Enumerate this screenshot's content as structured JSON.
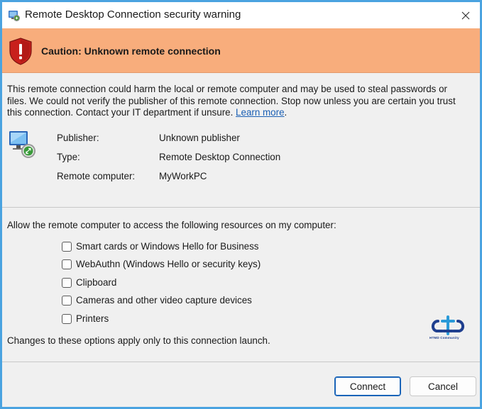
{
  "window": {
    "title": "Remote Desktop Connection security warning",
    "close_glyph": "✕"
  },
  "banner": {
    "text": "Caution: Unknown remote connection",
    "color": "#f8ad7c"
  },
  "warning": {
    "text": "This remote connection could harm the local or remote computer and may be used to steal passwords or files. We could not verify the publisher of this remote connection. Stop now unless you are certain you trust this connection. Contact your IT department if unsure. ",
    "link": "Learn more",
    "trailing": "."
  },
  "info": {
    "publisher_label": "Publisher:",
    "publisher_value": "Unknown publisher",
    "type_label": "Type:",
    "type_value": "Remote Desktop Connection",
    "remote_label": "Remote computer:",
    "remote_value": "MyWorkPC"
  },
  "access": {
    "label": "Allow the remote computer to access the following resources on my computer:",
    "options": [
      {
        "label": "Smart cards or Windows Hello for Business",
        "checked": false
      },
      {
        "label": "WebAuthn (Windows Hello or security keys)",
        "checked": false
      },
      {
        "label": "Clipboard",
        "checked": false
      },
      {
        "label": "Cameras and other video capture devices",
        "checked": false
      },
      {
        "label": "Printers",
        "checked": false
      }
    ],
    "changes_note": "Changes to these options apply only to this connection launch."
  },
  "watermark": {
    "text": "HTMD Community"
  },
  "buttons": {
    "connect": "Connect",
    "cancel": "Cancel"
  },
  "icons": {
    "title": "rdp-security-icon",
    "banner": "shield-warning-icon",
    "computer": "remote-computer-icon",
    "close": "close-icon"
  }
}
